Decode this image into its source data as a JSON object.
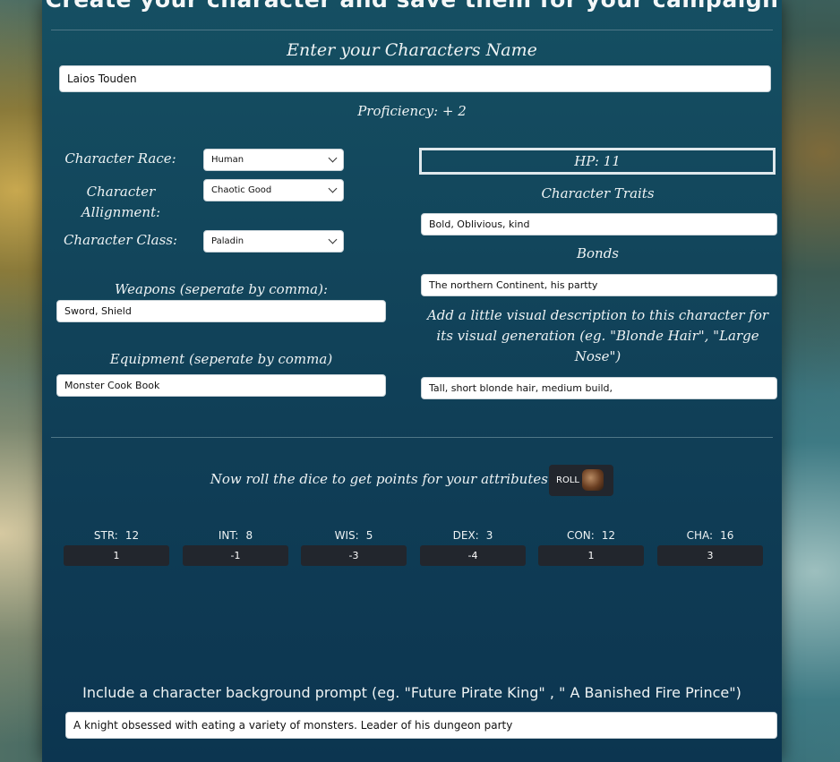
{
  "header": {
    "title": "Create your character and save them for your campaign"
  },
  "name_section": {
    "heading": "Enter your Characters Name",
    "value": "Laios Touden",
    "proficiency": "Proficiency: + 2"
  },
  "left": {
    "race_label": "Character Race:",
    "race_value": "Human",
    "alignment_label": "Character Allignment:",
    "alignment_value": "Chaotic Good",
    "class_label": "Character Class:",
    "class_value": "Paladin",
    "weapons_label": "Weapons (seperate by comma):",
    "weapons_value": "Sword, Shield",
    "equipment_label": "Equipment (seperate by comma)",
    "equipment_value": "Monster Cook Book"
  },
  "right": {
    "hp": "HP: 11",
    "traits_label": "Character Traits",
    "traits_value": "Bold, Oblivious, kind",
    "bonds_label": "Bonds",
    "bonds_value": "The northern Continent, his partty",
    "visual_label": "Add a little visual description to this character for its visual generation (eg. \"Blonde Hair\", \"Large Nose\")",
    "visual_value": "Tall, short blonde hair, medium build,"
  },
  "roll": {
    "prompt": "Now roll the dice to get points for your attributes:",
    "button_label": "ROLL",
    "icon": "dice-icon"
  },
  "attributes": [
    {
      "label": "STR:",
      "score": "12",
      "modifier": "1"
    },
    {
      "label": "INT:",
      "score": "8",
      "modifier": "-1"
    },
    {
      "label": "WIS:",
      "score": "5",
      "modifier": "-3"
    },
    {
      "label": "DEX:",
      "score": "3",
      "modifier": "-4"
    },
    {
      "label": "CON:",
      "score": "12",
      "modifier": "1"
    },
    {
      "label": "CHA:",
      "score": "16",
      "modifier": "3"
    }
  ],
  "background": {
    "prompt": "Include a character background prompt (eg. \"Future Pirate King\" , \" A Banished Fire Prince\")",
    "value": "A knight obsessed with eating a variety of monsters. Leader of his dungeon party"
  }
}
